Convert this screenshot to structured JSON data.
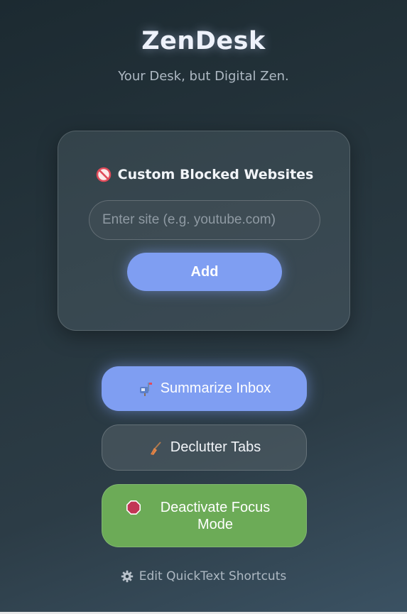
{
  "app": {
    "title": "ZenDesk",
    "subtitle": "Your Desk, but Digital Zen."
  },
  "blocked_sites": {
    "icon": "no-entry-icon",
    "title": "Custom Blocked Websites",
    "input_placeholder": "Enter site (e.g. youtube.com)",
    "input_value": "",
    "add_label": "Add"
  },
  "actions": {
    "summarize": {
      "icon": "mailbox-icon",
      "label": "Summarize Inbox"
    },
    "declutter": {
      "icon": "broom-icon",
      "label": "Declutter Tabs"
    },
    "deactivate": {
      "icon": "stop-sign-icon",
      "label": "Deactivate Focus Mode"
    }
  },
  "footer": {
    "icon": "gear-icon",
    "label": "Edit QuickText Shortcuts"
  },
  "colors": {
    "accent": "#7f9ef2",
    "focus_green": "#6cab57",
    "background": "#26353d"
  }
}
